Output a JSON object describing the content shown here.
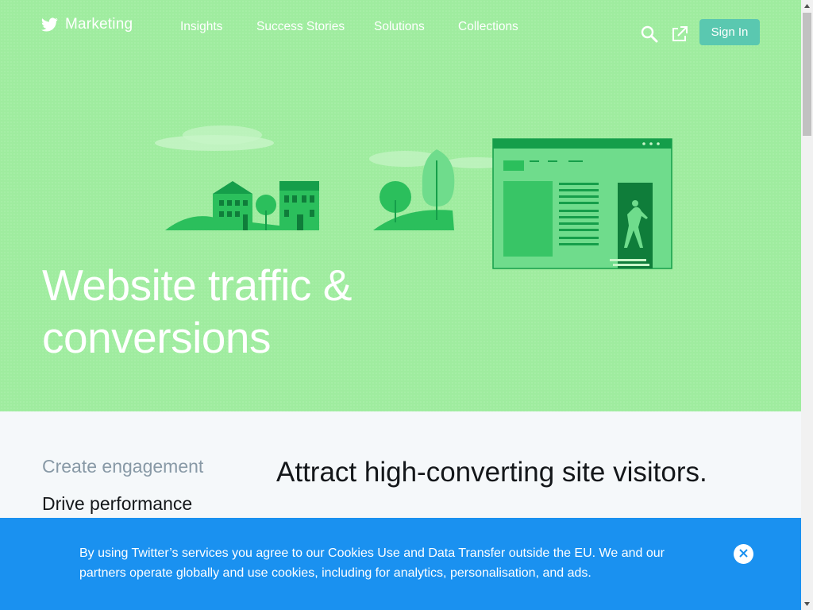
{
  "nav": {
    "brand_label": "Marketing",
    "links": [
      "Insights",
      "Success Stories",
      "Solutions",
      "Collections"
    ],
    "search_icon": "search-icon",
    "external_icon": "external-link-icon",
    "sign_in_label": "Sign In"
  },
  "hero": {
    "title": "Website traffic & conversions",
    "background": "#9fec9f"
  },
  "sidenav": {
    "items": [
      "Create engagement",
      "Drive performance"
    ],
    "active_index": 1
  },
  "main": {
    "heading": "Attract high-converting site visitors."
  },
  "cookie_banner": {
    "text": "By using Twitter’s services you agree to our Cookies Use and Data Transfer outside the EU. We and our partners operate globally and use cookies, including for analytics, personalisation, and ads.",
    "close_icon": "close-icon",
    "background": "#1a91f0"
  },
  "colors": {
    "accent_green": "#17a84b",
    "signin_button": "#5ac8b0",
    "text_dark": "#14171a",
    "text_muted": "#8899a6"
  }
}
